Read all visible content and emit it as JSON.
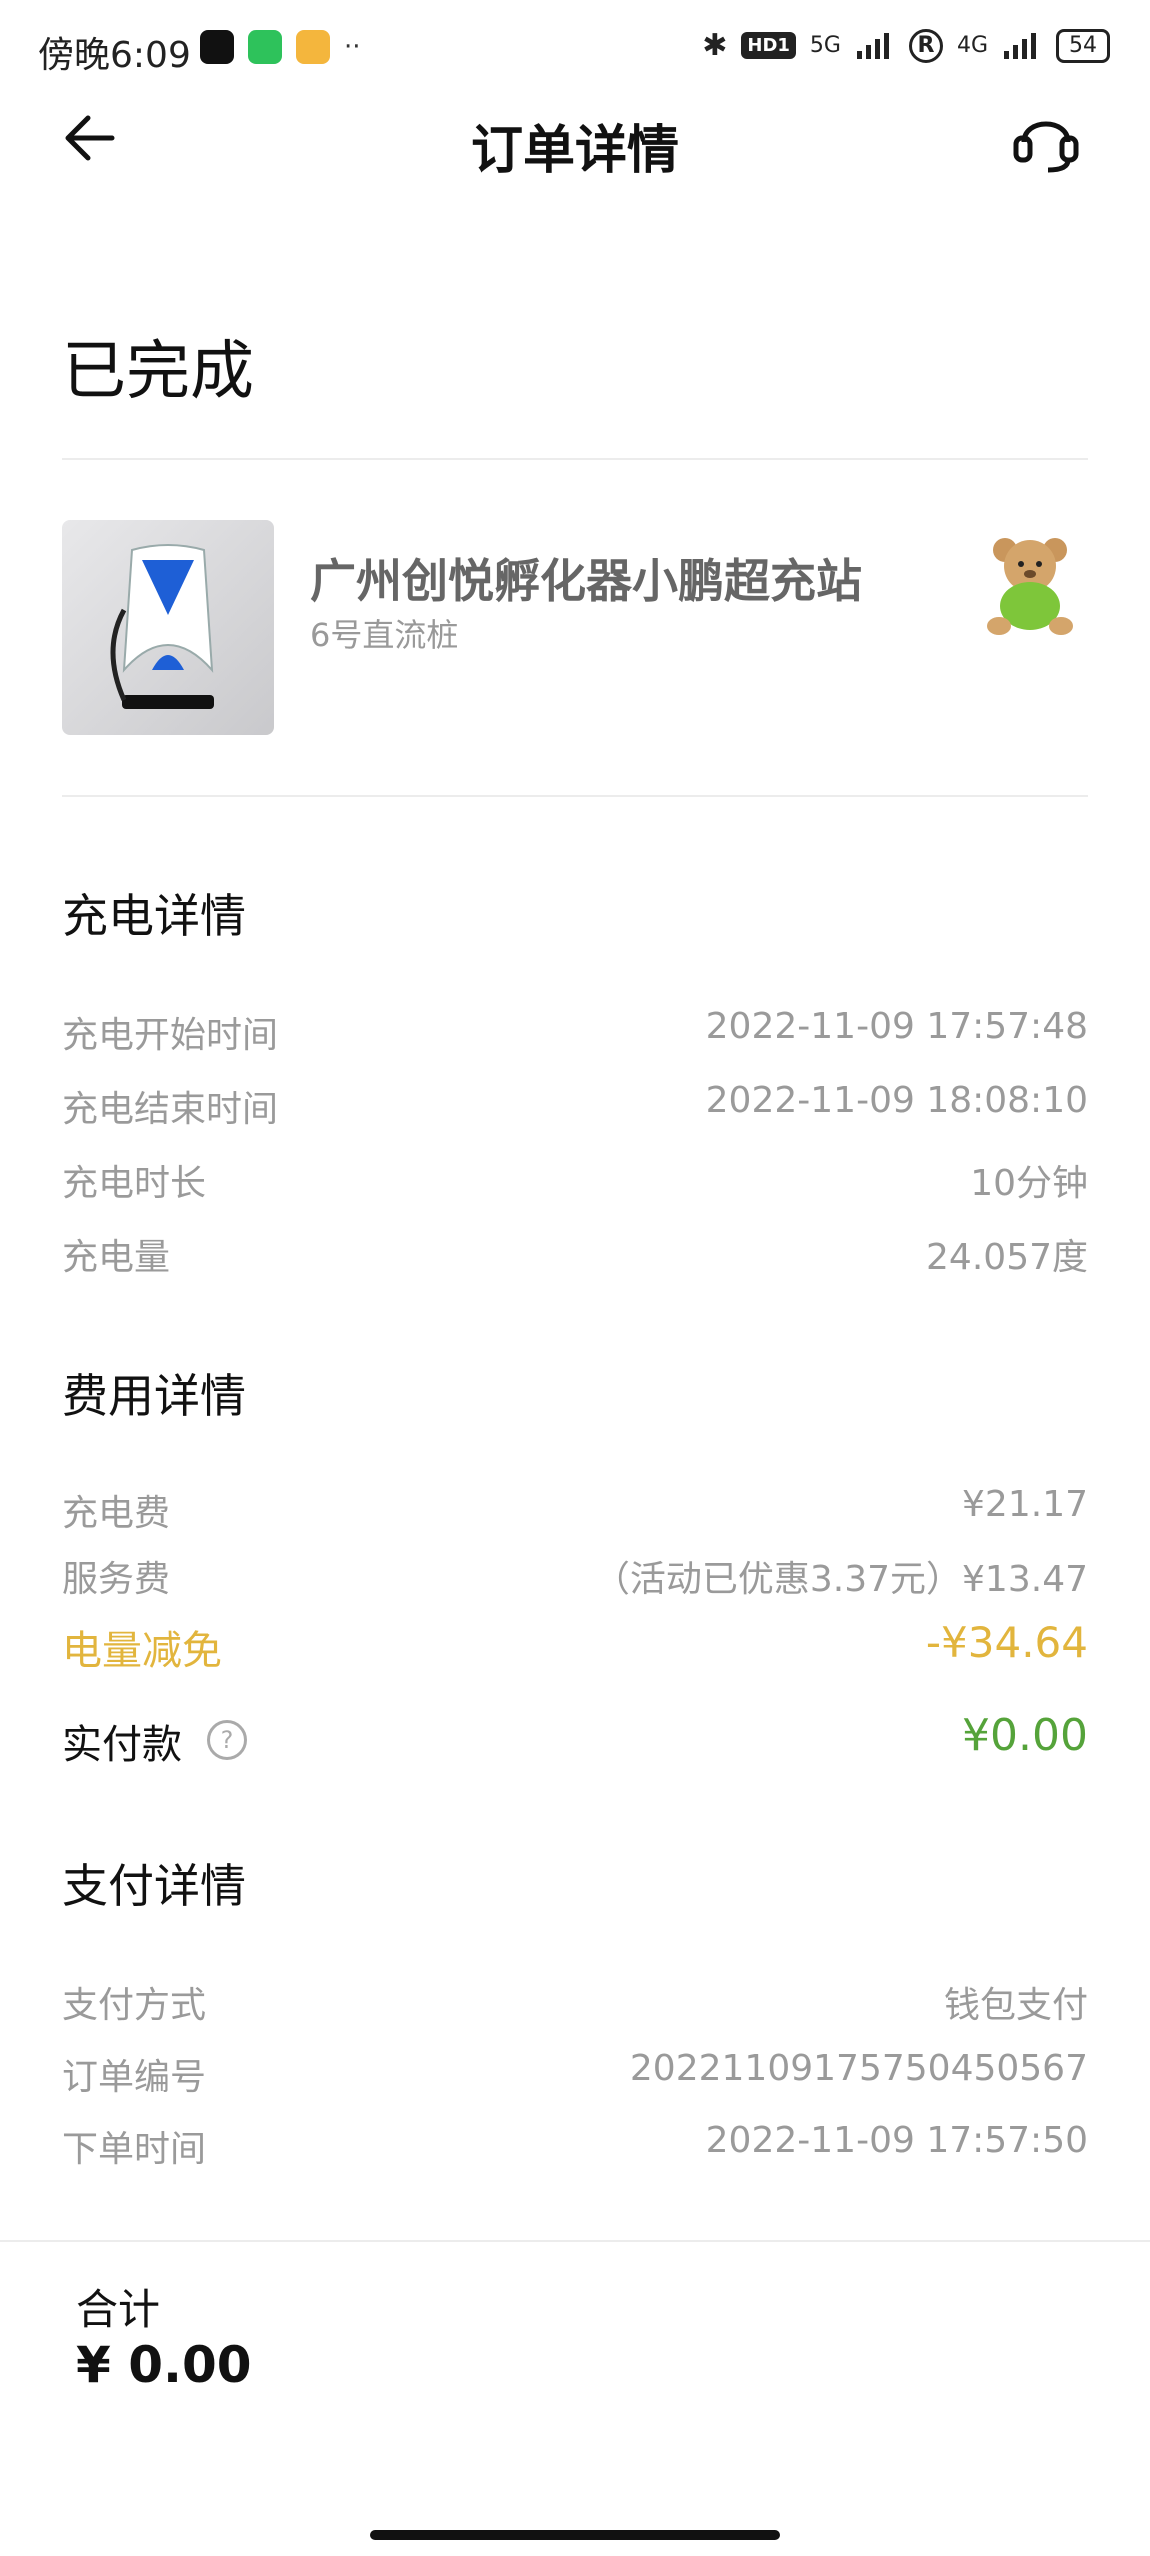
{
  "status_bar": {
    "time": "傍晚6:09",
    "net_5g": "5G",
    "net_4g": "4G",
    "hd": "HD1",
    "roaming": "R",
    "battery": "54"
  },
  "nav": {
    "title": "订单详情"
  },
  "order": {
    "status": "已完成",
    "station_name": "广州创悦孵化器小鹏超充站",
    "pile_name": "6号直流桩"
  },
  "charge_details": {
    "title": "充电详情",
    "rows": [
      {
        "label": "充电开始时间",
        "value": "2022-11-09 17:57:48"
      },
      {
        "label": "充电结束时间",
        "value": "2022-11-09 18:08:10"
      },
      {
        "label": "充电时长",
        "value": "10分钟"
      },
      {
        "label": "充电量",
        "value": "24.057度"
      }
    ]
  },
  "fee_details": {
    "title": "费用详情",
    "rows": [
      {
        "label": "充电费",
        "value": "¥21.17"
      },
      {
        "label": "服务费",
        "value": "（活动已优惠3.37元）¥13.47"
      },
      {
        "label": "电量减免",
        "value": "-¥34.64"
      }
    ],
    "paid_label": "实付款",
    "paid_value": "¥0.00",
    "help_glyph": "?"
  },
  "payment_details": {
    "title": "支付详情",
    "rows": [
      {
        "label": "支付方式",
        "value": "钱包支付"
      },
      {
        "label": "订单编号",
        "value": "20221109175750450567"
      },
      {
        "label": "下单时间",
        "value": "2022-11-09 17:57:50"
      }
    ]
  },
  "footer": {
    "total_label": "合计",
    "total_amount": "¥ 0.00"
  },
  "colors": {
    "gold": "#e2b53d",
    "green": "#55a33a",
    "muted": "#9a9a9a"
  }
}
